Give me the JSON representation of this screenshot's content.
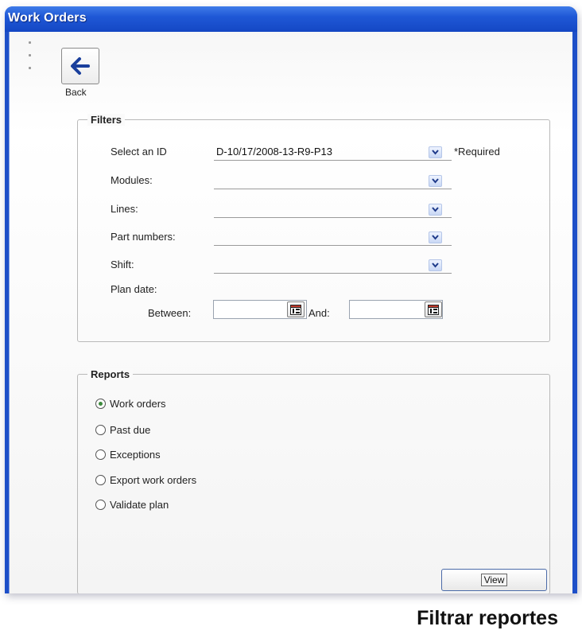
{
  "window": {
    "title": "Work Orders",
    "titlebar_color": "#1d4fc8"
  },
  "toolbar": {
    "back_label": "Back"
  },
  "filters": {
    "legend": "Filters",
    "select_id": {
      "label": "Select an ID",
      "value": "D-10/17/2008-13-R9-P13",
      "note": "*Required"
    },
    "modules": {
      "label": "Modules:",
      "value": ""
    },
    "lines": {
      "label": "Lines:",
      "value": ""
    },
    "part_numbers": {
      "label": "Part numbers:",
      "value": ""
    },
    "shift": {
      "label": "Shift:",
      "value": ""
    },
    "plan_date": {
      "label": "Plan date:",
      "between_label": "Between:",
      "and_label": "And:",
      "start_value": "",
      "end_value": ""
    }
  },
  "reports": {
    "legend": "Reports",
    "options": [
      {
        "label": "Work orders",
        "checked": true
      },
      {
        "label": "Past due",
        "checked": false
      },
      {
        "label": "Exceptions",
        "checked": false
      },
      {
        "label": "Export work orders",
        "checked": false
      },
      {
        "label": "Validate plan",
        "checked": false
      }
    ]
  },
  "actions": {
    "view_label": "View"
  },
  "caption": "Filtrar reportes",
  "icons": {
    "back": "arrow-left-icon",
    "dropdown": "chevron-down-icon",
    "calendar": "calendar-icon"
  }
}
